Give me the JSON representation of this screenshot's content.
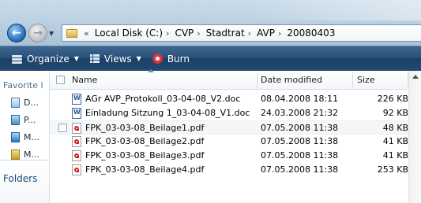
{
  "address": {
    "separator": "«",
    "crumbs": [
      "Local Disk (C:)",
      "CVP",
      "Stadtrat",
      "AVP",
      "20080403"
    ],
    "crumb_separator": "›"
  },
  "toolbar": {
    "organize": "Organize",
    "views": "Views",
    "burn": "Burn"
  },
  "nav": {
    "favorites_label": "Favorite l",
    "items": [
      "D...",
      "P...",
      "M...",
      "M..."
    ],
    "folders": "Folders"
  },
  "columns": {
    "name": "Name",
    "date": "Date modified",
    "size": "Size"
  },
  "files": [
    {
      "name": "AGr AVP_Protokoll_03-04-08_V2.doc",
      "date": "08.04.2008 18:11",
      "size": "226 KB",
      "icon": "word-doc-icon"
    },
    {
      "name": "Einladung Sitzung 1_03-04-08_V1.doc",
      "date": "24.03.2008 21:32",
      "size": "92 KB",
      "icon": "word-doc-icon"
    },
    {
      "name": "FPK_03-03-08_Beilage1.pdf",
      "date": "07.05.2008 11:38",
      "size": "48 KB",
      "icon": "pdf-icon"
    },
    {
      "name": "FPK_03-03-08_Beilage2.pdf",
      "date": "07.05.2008 11:38",
      "size": "41 KB",
      "icon": "pdf-icon"
    },
    {
      "name": "FPK_03-03-08_Beilage3.pdf",
      "date": "07.05.2008 11:38",
      "size": "41 KB",
      "icon": "pdf-icon"
    },
    {
      "name": "FPK_03-03-08_Beilage4.pdf",
      "date": "07.05.2008 11:38",
      "size": "253 KB",
      "icon": "pdf-icon"
    }
  ]
}
